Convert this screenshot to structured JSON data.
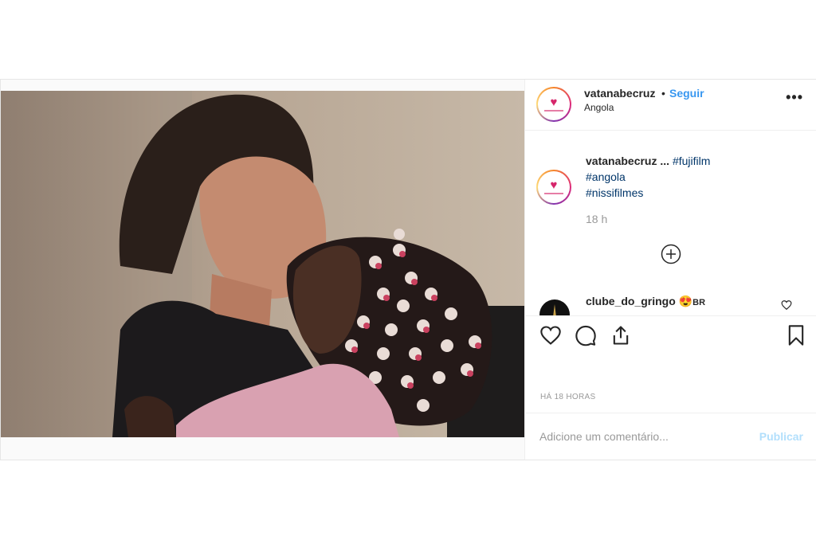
{
  "post": {
    "username": "vatanabecruz",
    "separator": "•",
    "follow_label": "Seguir",
    "location": "Angola",
    "more_icon": "more-horizontal-icon"
  },
  "caption": {
    "username": "vatanabecruz ...",
    "tags": [
      "#fujifilm",
      "#angola",
      "#nissifilmes"
    ],
    "age": "18 h"
  },
  "comment": {
    "username": "clube_do_gringo",
    "badge_emoji": "😍",
    "badge_text": "BR"
  },
  "actions": {
    "like_icon": "heart-icon",
    "comment_icon": "comment-icon",
    "share_icon": "share-icon",
    "save_icon": "bookmark-icon"
  },
  "timestamp": "HÁ 18 HORAS",
  "add_comment": {
    "placeholder": "Adicione um comentário...",
    "publish_label": "Publicar"
  },
  "colors": {
    "link_blue": "#3897f0",
    "publish_disabled": "#b2dffc",
    "brand_pink": "#d6266b"
  }
}
